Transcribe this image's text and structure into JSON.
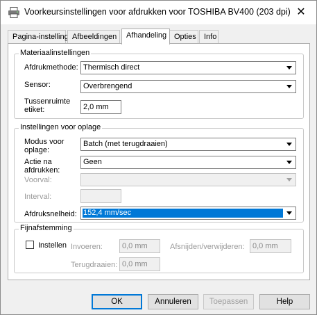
{
  "window": {
    "title": "Voorkeursinstellingen voor afdrukken voor TOSHIBA BV400 (203 dpi)",
    "close_glyph": "✕"
  },
  "tabs": [
    "Pagina-instelling",
    "Afbeeldingen",
    "Afhandeling",
    "Opties",
    "Info"
  ],
  "active_tab": "Afhandeling",
  "material": {
    "legend": "Materiaalinstellingen",
    "print_method_label": "Afdrukmethode:",
    "print_method_value": "Thermisch direct",
    "sensor_label": "Sensor:",
    "sensor_value": "Overbrengend",
    "gap_label_line1": "Tussenruimte",
    "gap_label_line2": "etiket:",
    "gap_value": "2,0 mm"
  },
  "output": {
    "legend": "Instellingen voor oplage",
    "mode_label_line1": "Modus voor",
    "mode_label_line2": "oplage:",
    "mode_value": "Batch (met terugdraaien)",
    "action_label_line1": "Actie na",
    "action_label_line2": "afdrukken:",
    "action_value": "Geen",
    "prefeed_label": "Voorval:",
    "prefeed_value": "",
    "interval_label": "Interval:",
    "interval_value": "",
    "speed_label": "Afdruksnelheid:",
    "speed_value": "152,4 mm/sec"
  },
  "fine": {
    "legend": "Fijnafstemming",
    "enable_label": "Instellen",
    "enable_checked": false,
    "feed_label": "Invoeren:",
    "feed_value": "0,0 mm",
    "cut_label": "Afsnijden/verwijderen:",
    "cut_value": "0,0 mm",
    "back_label": "Terugdraaien:",
    "back_value": "0,0 mm"
  },
  "buttons": {
    "ok": "OK",
    "cancel": "Annuleren",
    "apply": "Toepassen",
    "help": "Help"
  },
  "colors": {
    "selection": "#0078d7",
    "window_bg": "#f0f0f0",
    "panel_bg": "#ffffff"
  }
}
